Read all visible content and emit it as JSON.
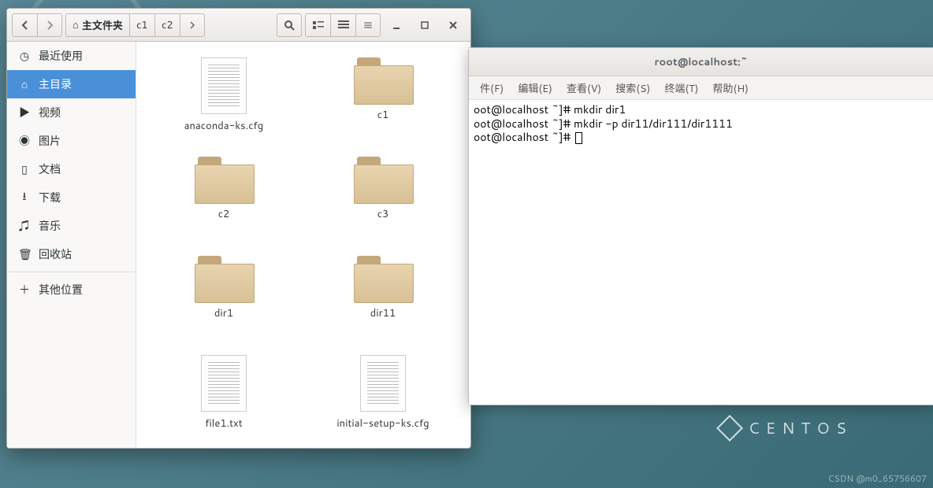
{
  "file_manager": {
    "breadcrumb": {
      "home_label": "主文件夹",
      "seg1": "c1",
      "seg2": "c2"
    },
    "sidebar": {
      "recent": "最近使用",
      "home": "主目录",
      "videos": "视频",
      "pictures": "图片",
      "documents": "文档",
      "downloads": "下载",
      "music": "音乐",
      "trash": "回收站",
      "other": "其他位置"
    },
    "files": [
      {
        "name": "anaconda-ks.cfg",
        "type": "file"
      },
      {
        "name": "c1",
        "type": "folder"
      },
      {
        "name": "c2",
        "type": "folder"
      },
      {
        "name": "c3",
        "type": "folder"
      },
      {
        "name": "dir1",
        "type": "folder"
      },
      {
        "name": "dir11",
        "type": "folder"
      },
      {
        "name": "file1.txt",
        "type": "file"
      },
      {
        "name": "initial-setup-ks.cfg",
        "type": "file"
      }
    ]
  },
  "terminal": {
    "title": "root@localhost:~",
    "menu": {
      "file": "件(F)",
      "edit": "编辑(E)",
      "view": "查看(V)",
      "search": "搜索(S)",
      "terminal": "终端(T)",
      "help": "帮助(H)"
    },
    "lines": [
      "oot@localhost ~]# mkdir dir1",
      "oot@localhost ~]# mkdir -p dir11/dir111/dir1111",
      "oot@localhost ~]# "
    ]
  },
  "desktop": {
    "logo_text": "CENTOS",
    "watermark": "CSDN @m0_65756607"
  }
}
